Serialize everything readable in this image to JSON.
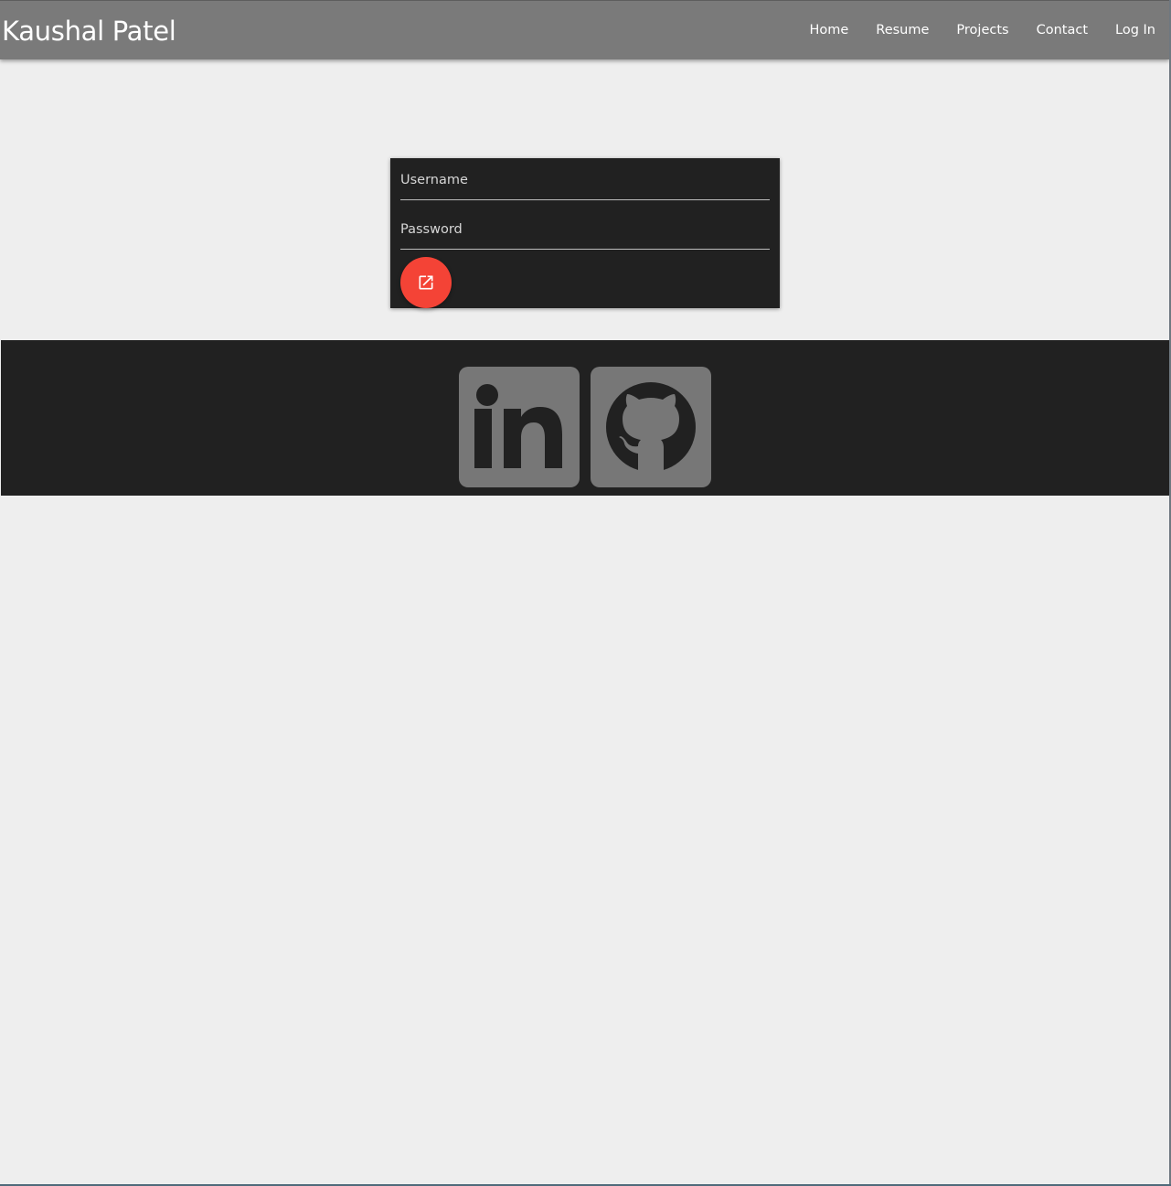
{
  "header": {
    "brand": "Kaushal Patel",
    "nav": [
      {
        "label": "Home"
      },
      {
        "label": "Resume"
      },
      {
        "label": "Projects"
      },
      {
        "label": "Contact"
      },
      {
        "label": "Log In"
      }
    ]
  },
  "login": {
    "username_placeholder": "Username",
    "password_placeholder": "Password",
    "submit_icon": "open-in-new-icon"
  },
  "footer": {
    "social": [
      {
        "icon": "linkedin-icon"
      },
      {
        "icon": "github-icon"
      }
    ]
  },
  "colors": {
    "header_bg": "#7a7a7a",
    "page_bg": "#eeeeee",
    "card_bg": "#212121",
    "footer_bg": "#212121",
    "accent": "#f44336",
    "social_icon_bg": "#777777"
  }
}
